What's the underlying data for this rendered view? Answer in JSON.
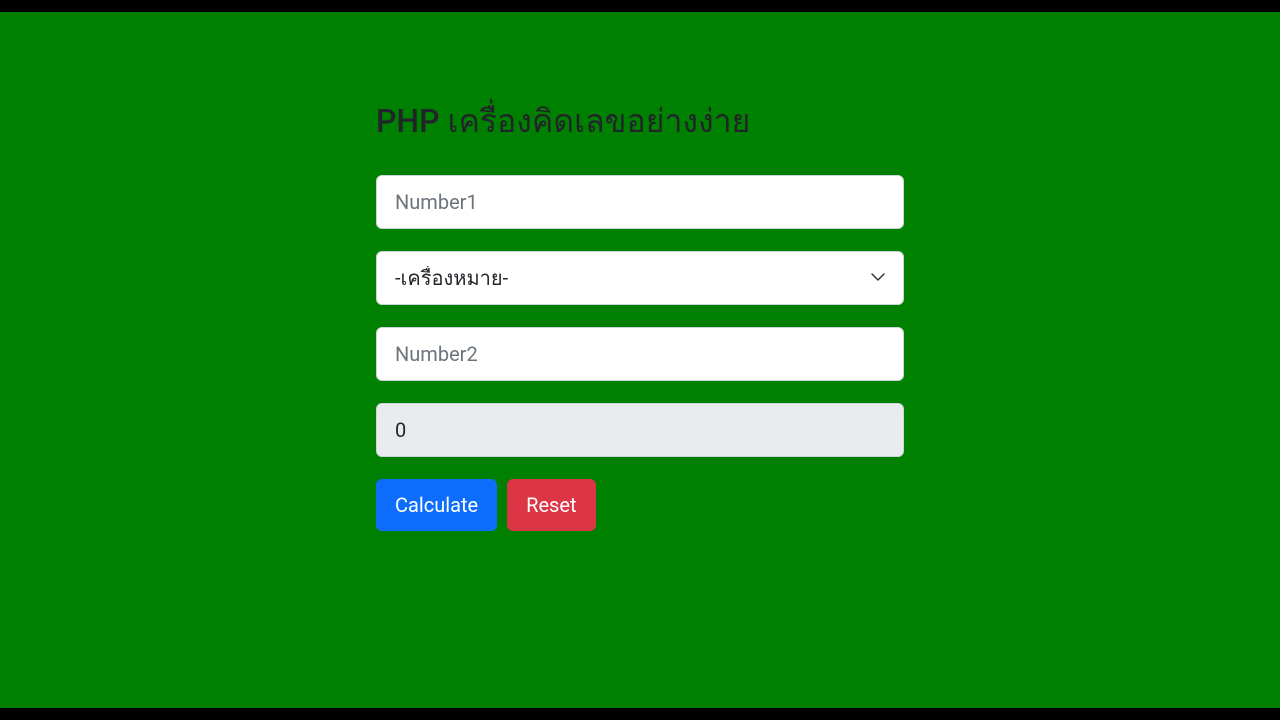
{
  "title": "PHP เครื่องคิดเลขอย่างง่าย",
  "form": {
    "number1": {
      "value": "",
      "placeholder": "Number1"
    },
    "operator": {
      "selected": "-เครื่องหมาย-"
    },
    "number2": {
      "value": "",
      "placeholder": "Number2"
    },
    "result": {
      "value": "0"
    },
    "calculate_label": "Calculate",
    "reset_label": "Reset"
  },
  "colors": {
    "page_bg": "#008000",
    "primary": "#0d6efd",
    "danger": "#dc3545"
  }
}
